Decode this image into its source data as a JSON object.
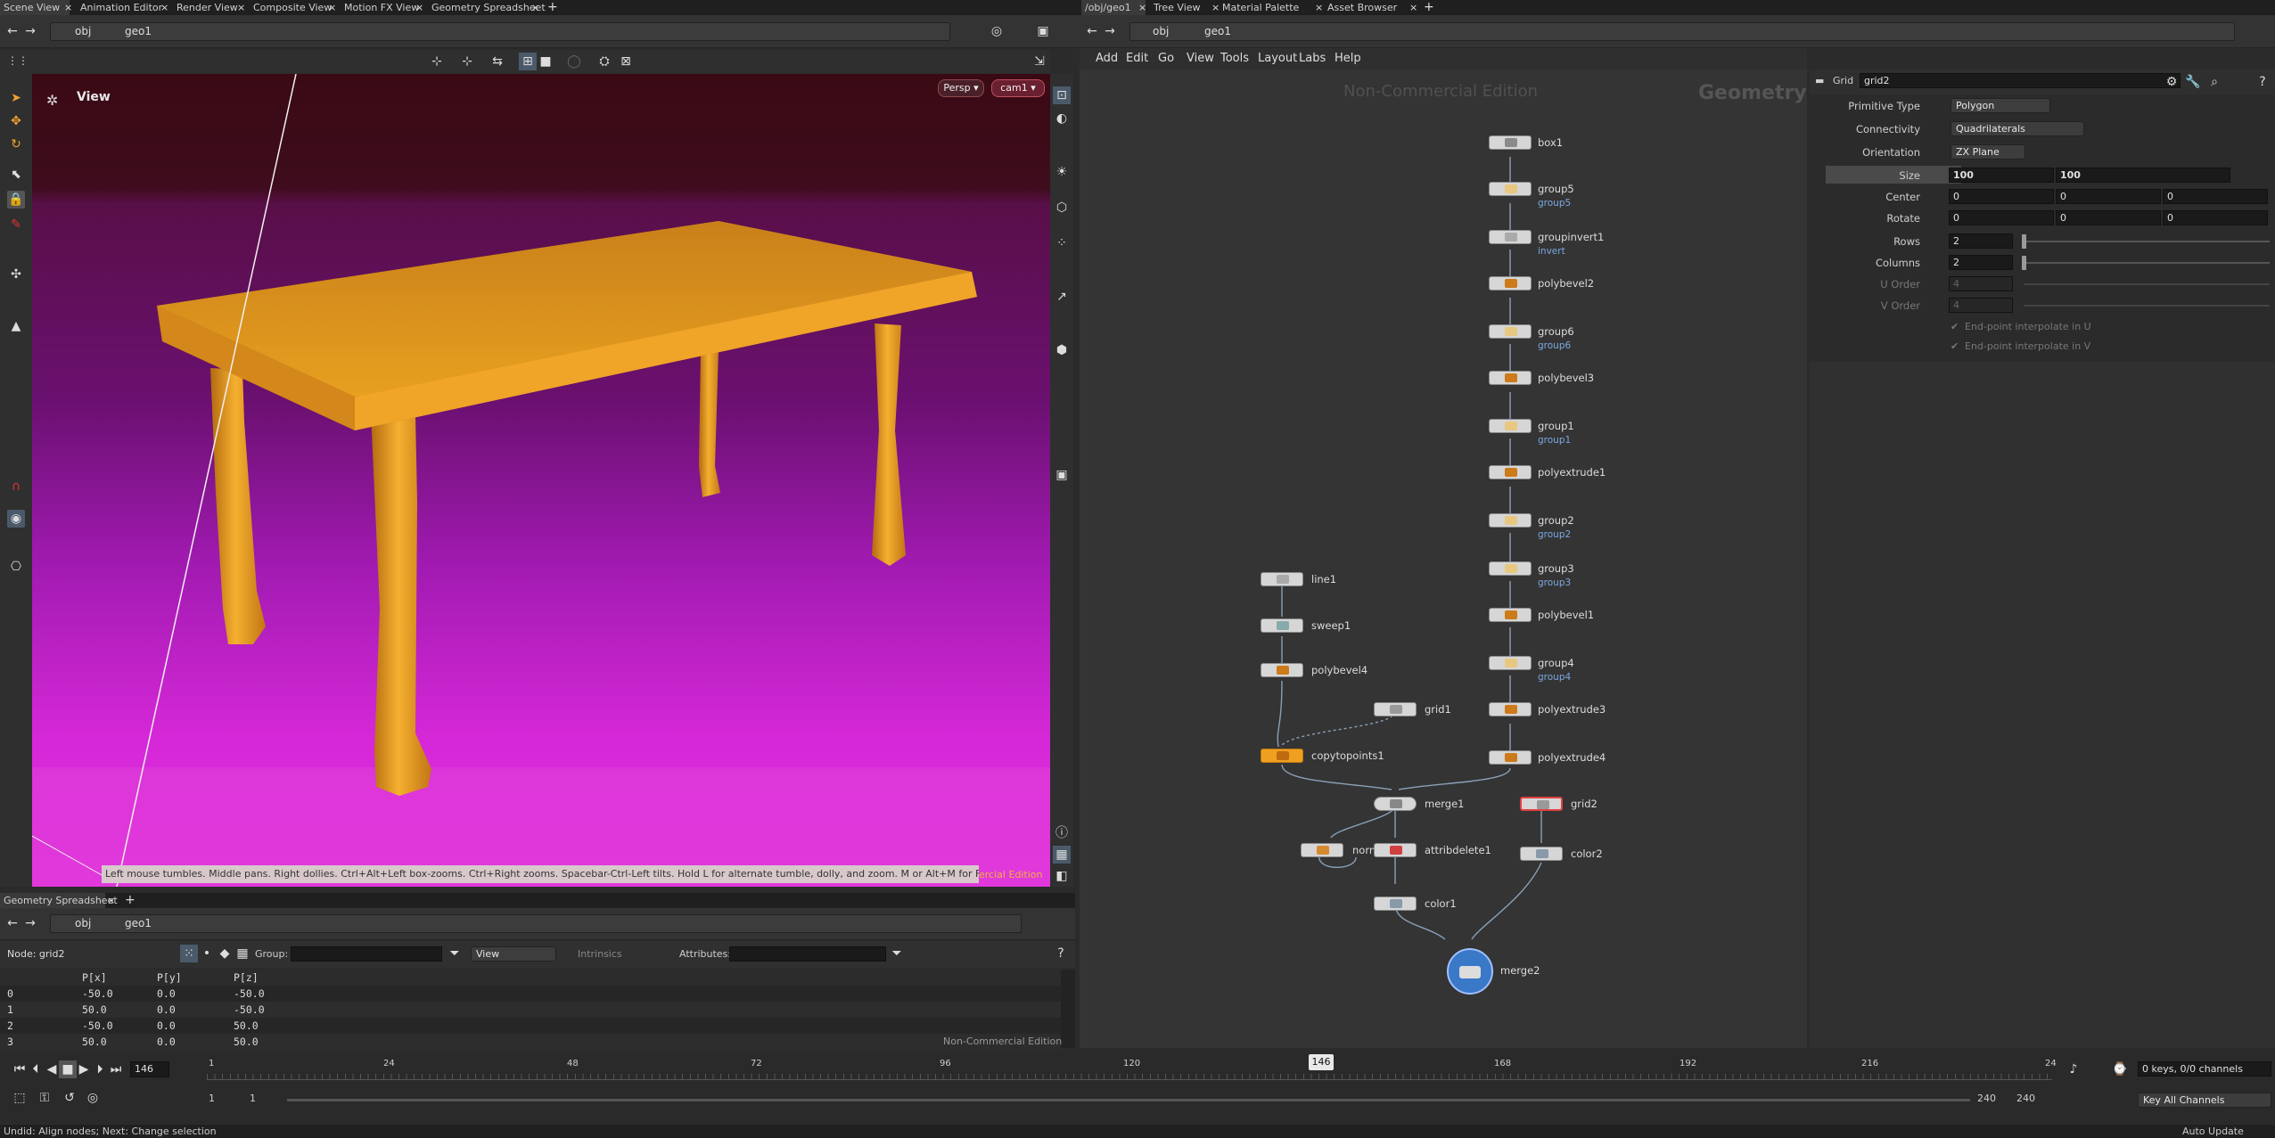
{
  "left_tabs": [
    "Scene View",
    "Animation Editor",
    "Render View",
    "Composite View",
    "Motion FX View",
    "Geometry Spreadsheet"
  ],
  "right_tabs": [
    "/obj/geo1",
    "Tree View",
    "Material Palette",
    "Asset Browser"
  ],
  "viewer": {
    "path": [
      "obj",
      "geo1"
    ],
    "title": "View",
    "persp": "Persp",
    "cam": "cam1",
    "tip": "Left mouse tumbles. Middle pans. Right dollies. Ctrl+Alt+Left box-zooms. Ctrl+Right zooms. Spacebar-Ctrl-Left tilts. Hold L for alternate tumble, dolly, and zoom. M or Alt+M for First Person Navigation.",
    "watermark": "ercial Edition"
  },
  "network": {
    "path": [
      "obj",
      "geo1"
    ],
    "menus": [
      "Add",
      "Edit",
      "Go",
      "View",
      "Tools",
      "Layout",
      "Labs",
      "Help"
    ],
    "watermark": "Non-Commercial Edition",
    "context": "Geometry",
    "nodes": {
      "box1": "box1",
      "group5": "group5",
      "group5s": "group5",
      "groupinvert1": "groupinvert1",
      "invert": "invert",
      "polybevel2": "polybevel2",
      "group6": "group6",
      "group6s": "group6",
      "polybevel3": "polybevel3",
      "group1": "group1",
      "group1s": "group1",
      "polyextrude1": "polyextrude1",
      "group2": "group2",
      "group2s": "group2",
      "group3": "group3",
      "group3s": "group3",
      "polybevel1": "polybevel1",
      "group4": "group4",
      "group4s": "group4",
      "polyextrude3": "polyextrude3",
      "polyextrude4": "polyextrude4",
      "line1": "line1",
      "sweep1": "sweep1",
      "polybevel4": "polybevel4",
      "grid1": "grid1",
      "copytopoints1": "copytopoints1",
      "merge1": "merge1",
      "grid2": "grid2",
      "norm": "norm",
      "attribdelete1": "attribdelete1",
      "color2": "color2",
      "color1": "color1",
      "merge2": "merge2"
    }
  },
  "params": {
    "type": "Grid",
    "name": "grid2",
    "primitive_type_label": "Primitive Type",
    "primitive_type": "Polygon",
    "connectivity_label": "Connectivity",
    "connectivity": "Quadrilaterals",
    "orientation_label": "Orientation",
    "orientation": "ZX Plane",
    "size_label": "Size",
    "size_x": "100",
    "size_y": "100",
    "center_label": "Center",
    "center": [
      "0",
      "0",
      "0"
    ],
    "rotate_label": "Rotate",
    "rotate": [
      "0",
      "0",
      "0"
    ],
    "rows_label": "Rows",
    "rows": "2",
    "columns_label": "Columns",
    "columns": "2",
    "uorder_label": "U Order",
    "uorder": "4",
    "vorder_label": "V Order",
    "vorder": "4",
    "endu": "End-point interpolate in U",
    "endv": "End-point interpolate in V"
  },
  "spreadsheet": {
    "tab": "Geometry Spreadsheet",
    "path": [
      "obj",
      "geo1"
    ],
    "node_label": "Node: grid2",
    "group_label": "Group:",
    "view": "View",
    "intrinsics": "Intrinsics",
    "attributes_label": "Attributes:",
    "columns": [
      "P[x]",
      "P[y]",
      "P[z]"
    ],
    "rows": [
      [
        "0",
        "-50.0",
        "0.0",
        "-50.0"
      ],
      [
        "1",
        "50.0",
        "0.0",
        "-50.0"
      ],
      [
        "2",
        "-50.0",
        "0.0",
        "50.0"
      ],
      [
        "3",
        "50.0",
        "0.0",
        "50.0"
      ]
    ],
    "watermark": "Non-Commercial Edition"
  },
  "timeline": {
    "frame": "146",
    "marker": "146",
    "ticks": [
      "1",
      "24",
      "48",
      "72",
      "96",
      "120",
      "168",
      "192",
      "216",
      "24"
    ],
    "start1": "1",
    "start2": "1",
    "end1": "240",
    "end2": "240",
    "keys": "0 keys, 0/0 channels",
    "key_all": "Key All Channels",
    "auto_update": "Auto Update"
  },
  "status": "Undid: Align nodes; Next: Change selection"
}
